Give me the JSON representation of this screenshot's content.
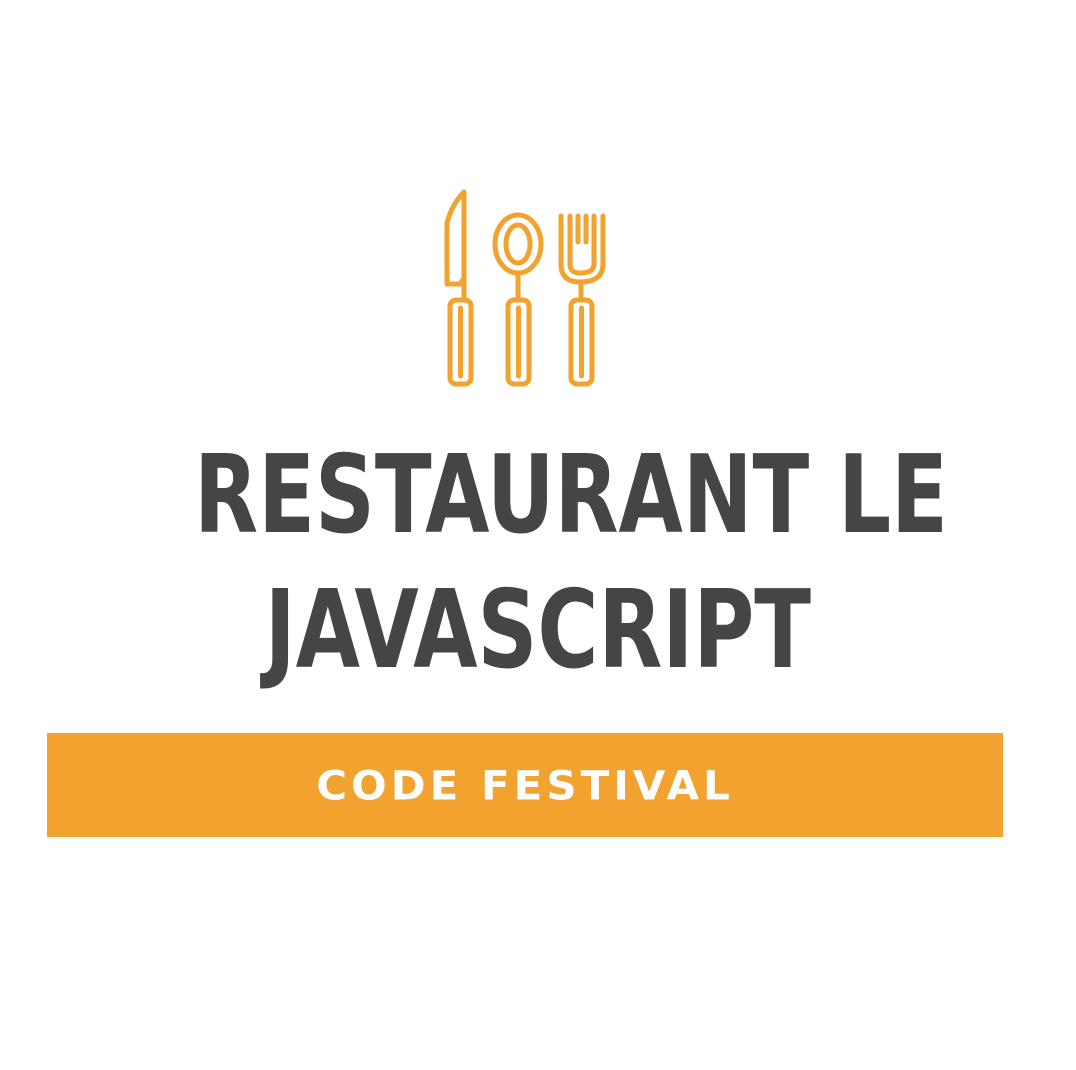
{
  "colors": {
    "accent": "#F2A22E",
    "text_dark": "#454545",
    "background": "#FFFFFF",
    "banner_text": "#FFFFFF"
  },
  "icon": {
    "name": "cutlery-icon"
  },
  "title": {
    "line1": "RESTAURANT LE",
    "line2": "JAVASCRIPT"
  },
  "banner": {
    "label": "CODE FESTIVAL"
  }
}
